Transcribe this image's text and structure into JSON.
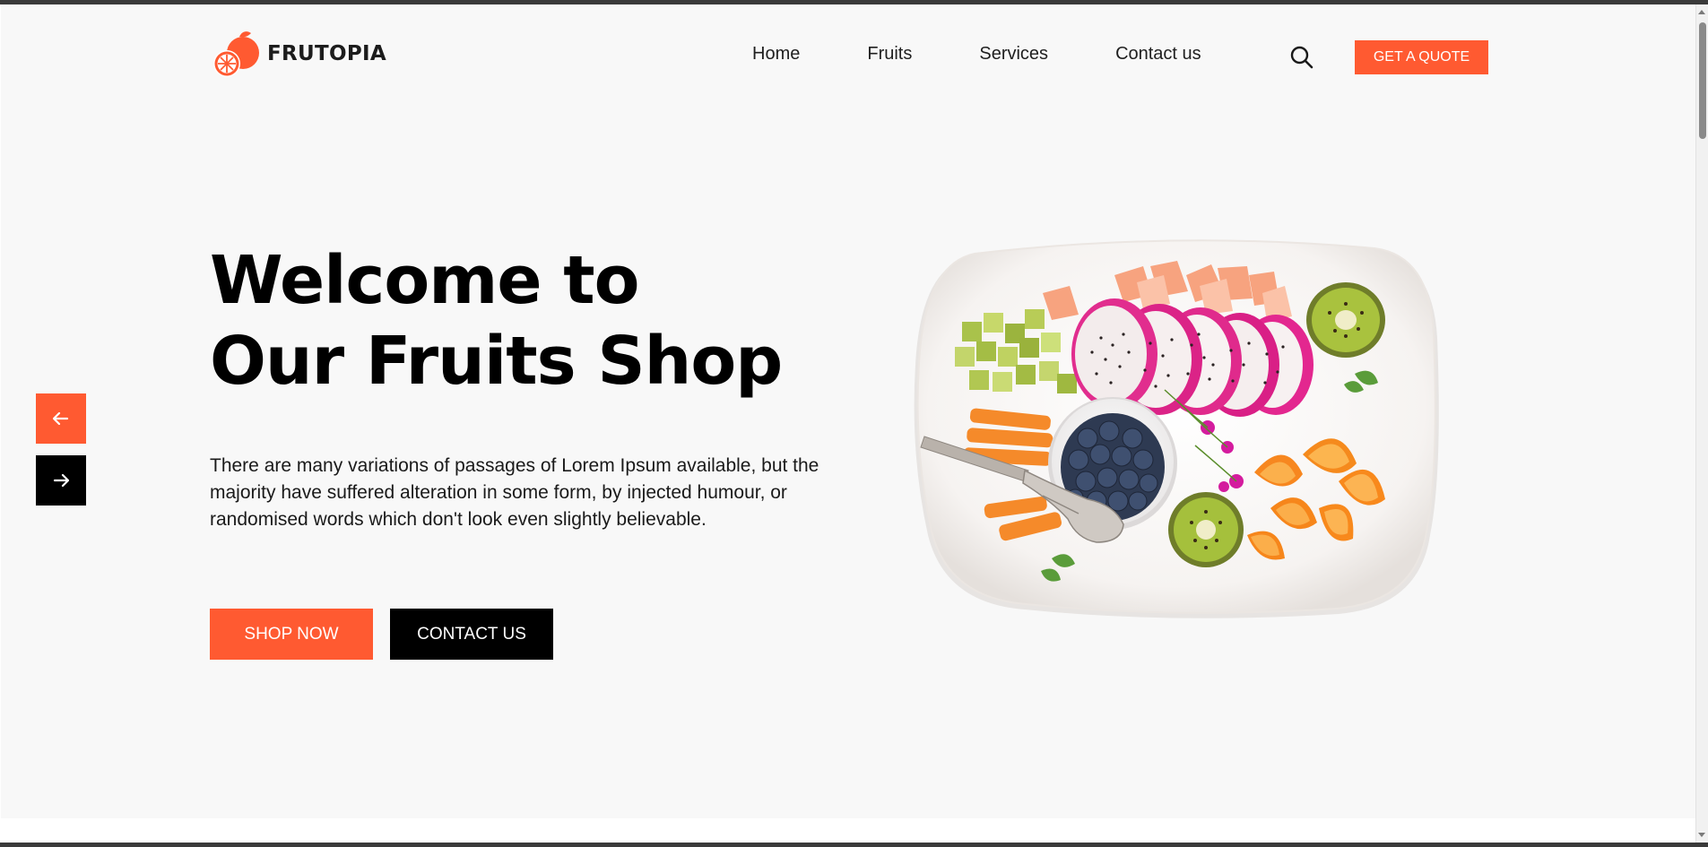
{
  "brand": {
    "name": "FRUTOPIA",
    "accent": "#ff5a31"
  },
  "nav": {
    "items": [
      "Home",
      "Fruits",
      "Services",
      "Contact us"
    ],
    "search_icon": "search-icon",
    "quote_label": "GET A QUOTE"
  },
  "hero": {
    "title_line1": "Welcome to",
    "title_line2": "Our Fruits Shop",
    "description": "There are many variations of passages of Lorem Ipsum available, but the majority have suffered alteration in some form, by injected humour, or randomised words which don't look even slightly believable.",
    "shop_label": "SHOP NOW",
    "contact_label": "CONTACT US",
    "image_icon": "fruit-plate-image"
  },
  "slider": {
    "prev_icon": "arrow-left-icon",
    "next_icon": "arrow-right-icon"
  }
}
